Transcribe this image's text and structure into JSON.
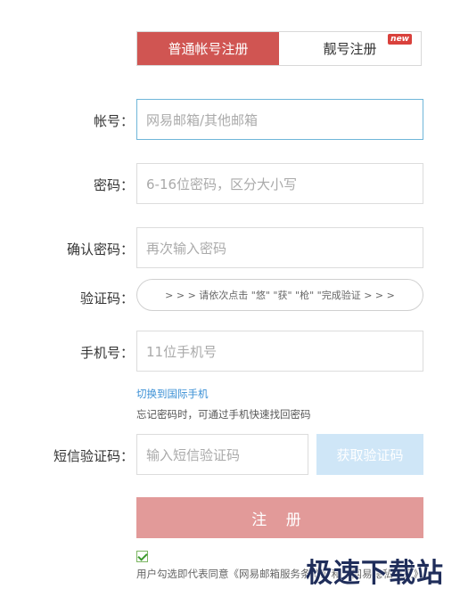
{
  "tabs": {
    "normal": "普通帐号注册",
    "vanity": "靓号注册",
    "new_badge": "new"
  },
  "account": {
    "label": "帐号：",
    "placeholder": "网易邮箱/其他邮箱"
  },
  "password": {
    "label": "密码：",
    "placeholder": "6-16位密码，区分大小写"
  },
  "confirm": {
    "label": "确认密码：",
    "placeholder": "再次输入密码"
  },
  "captcha": {
    "label": "验证码：",
    "prompt": "> > > 请依次点击 \"悠\" \"获\" \"枪\" \"完成验证 > > >"
  },
  "phone": {
    "label": "手机号：",
    "placeholder": "11位手机号",
    "switch_link": "切换到国际手机",
    "hint": "忘记密码时，可通过手机快速找回密码"
  },
  "sms": {
    "label": "短信验证码：",
    "placeholder": "输入短信验证码",
    "button": "获取验证码"
  },
  "submit": "注 册",
  "agreement": {
    "text": "用户勾选即代表同意《网易邮箱服务条款》和《网易隐私政策》",
    "checked": true
  },
  "watermark": "极速下载站"
}
